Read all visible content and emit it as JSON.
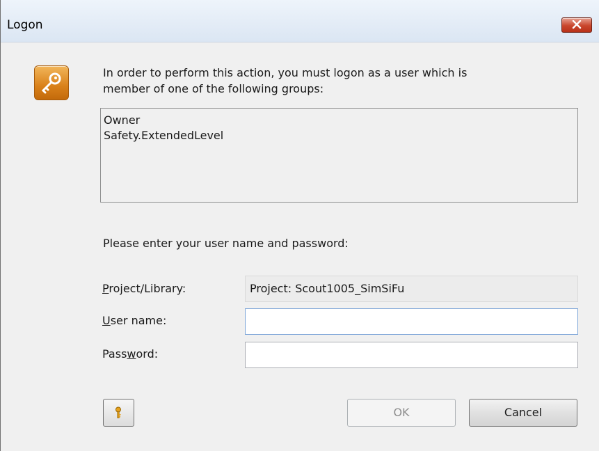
{
  "window": {
    "title": "Logon"
  },
  "message": {
    "line1": "In order to perform this action, you must logon as a user which is",
    "line2": "member of one of the following groups:"
  },
  "groups": [
    "Owner",
    "Safety.ExtendedLevel"
  ],
  "prompt": "Please enter your user name and password:",
  "form": {
    "project_label_accel": "P",
    "project_label_rest": "roject/Library:",
    "project_value": "Project: Scout1005_SimSiFu",
    "user_label_accel": "U",
    "user_label_rest": "ser name:",
    "user_value": "",
    "password_label_pre": "Pass",
    "password_label_accel": "w",
    "password_label_rest": "ord:",
    "password_value": ""
  },
  "buttons": {
    "ok": "OK",
    "cancel": "Cancel"
  },
  "icons": {
    "app": "key-icon",
    "close": "close-icon",
    "help": "key-small-icon"
  },
  "colors": {
    "close_button": "#c9462c",
    "app_icon": "#d9811a"
  }
}
